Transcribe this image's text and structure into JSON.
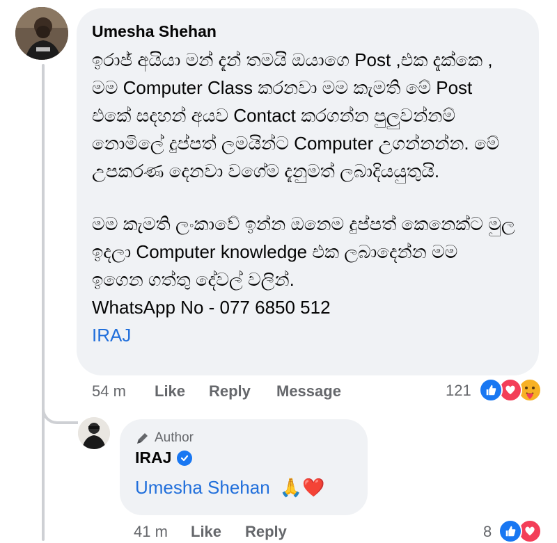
{
  "comment": {
    "author": "Umesha Shehan",
    "lines": [
      "ඉරාජ් අයියා මන් දැන් තමයි ඔයාගෙ Post ,එක දැක්කෙ ,",
      "මම Computer Class කරනවා මම කැමති මේ Post",
      "එකේ සදහන් අයව Contact කරගන්න පුලුවන්නම්",
      "නොමිලේ දුප්පත් ලමයින්ට Computer උගන්නන්න. මේ",
      "උපකරණ දෙනවා වගේම දැනුමත් ලබාදියයුතුයි."
    ],
    "lines2": [
      "මම කැමති ලංකාවේ ඉන්න ඔනෙම දුප්පත් කෙනෙක්ට මුල",
      "ඉදලා Computer knowledge එක ලබාදෙන්න මම",
      "ඉගෙන ගත්තු දේවල් වලින්.",
      "WhatsApp No - 077 6850 512"
    ],
    "tag": "IRAJ",
    "time": "54 m",
    "like": "Like",
    "reply": "Reply",
    "message": "Message",
    "reaction_count": "121"
  },
  "reply": {
    "badge": "Author",
    "author": "IRAJ",
    "mention": "Umesha Shehan",
    "emojis": "🙏❤️",
    "time": "41 m",
    "like": "Like",
    "reply": "Reply",
    "reaction_count": "8"
  },
  "colors": {
    "link": "#216fdb",
    "muted": "#65676b",
    "bubble": "#f0f2f5",
    "like": "#1877f2",
    "love": "#f33e58"
  }
}
